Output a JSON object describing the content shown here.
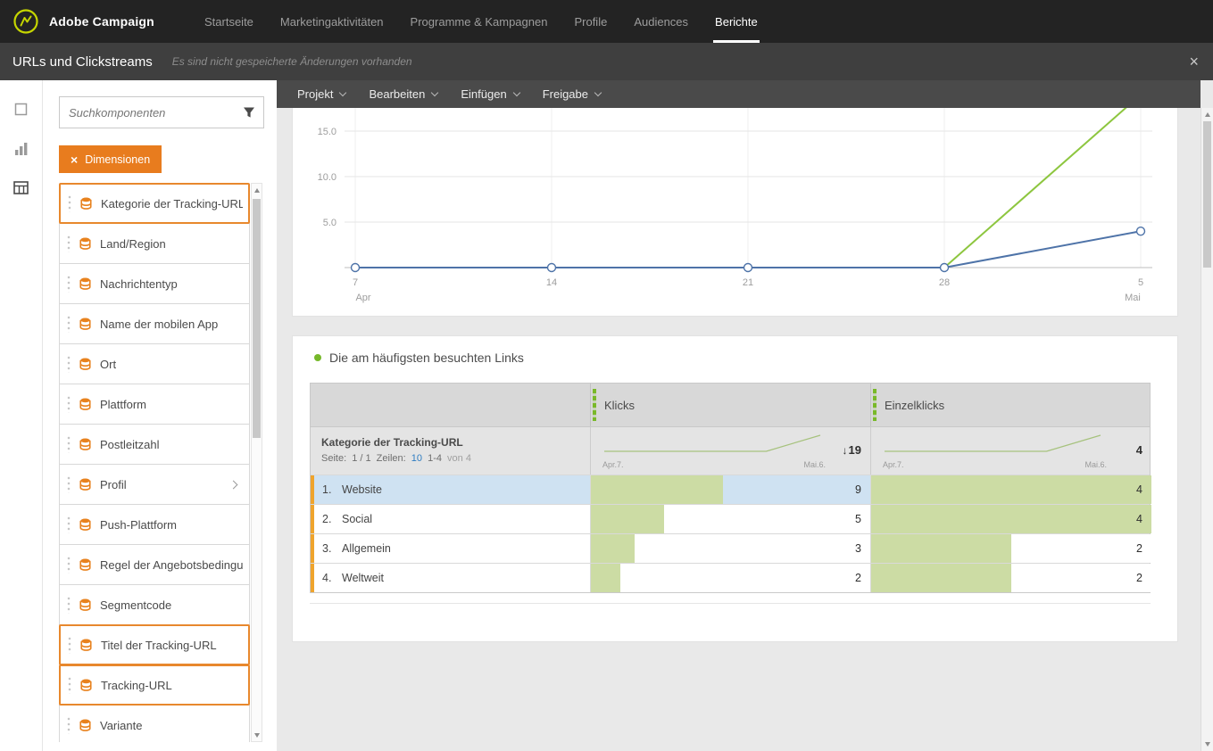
{
  "topnav": {
    "brand": "Adobe Campaign",
    "items": [
      {
        "label": "Startseite",
        "active": false
      },
      {
        "label": "Marketingaktivitäten",
        "active": false
      },
      {
        "label": "Programme & Kampagnen",
        "active": false
      },
      {
        "label": "Profile",
        "active": false
      },
      {
        "label": "Audiences",
        "active": false
      },
      {
        "label": "Berichte",
        "active": true
      }
    ]
  },
  "subheader": {
    "title": "URLs und Clickstreams",
    "status": "Es sind nicht gespeicherte Änderungen vorhanden",
    "close_glyph": "×"
  },
  "left_rail": {
    "icons": [
      "component-square-icon",
      "bar-chart-icon",
      "table-grid-icon"
    ]
  },
  "palette": {
    "search_placeholder": "Suchkomponenten",
    "category_button_label": "Dimensionen",
    "category_button_icon": "×",
    "items": [
      {
        "label": "Kategorie der Tracking-URL",
        "highlighted": true
      },
      {
        "label": "Land/Region"
      },
      {
        "label": "Nachrichtentyp"
      },
      {
        "label": "Name der mobilen App"
      },
      {
        "label": "Ort"
      },
      {
        "label": "Plattform"
      },
      {
        "label": "Postleitzahl"
      },
      {
        "label": "Profil",
        "expandable": true
      },
      {
        "label": "Push-Plattform"
      },
      {
        "label": "Regel der Angebotsbedingung"
      },
      {
        "label": "Segmentcode"
      },
      {
        "label": "Titel der Tracking-URL",
        "highlighted": true
      },
      {
        "label": "Tracking-URL",
        "highlighted": true
      },
      {
        "label": "Variante"
      }
    ]
  },
  "menubar": {
    "items": [
      "Projekt",
      "Bearbeiten",
      "Einfügen",
      "Freigabe"
    ]
  },
  "chart_data": {
    "type": "line",
    "title": "",
    "xlabel": "",
    "ylabel": "",
    "x_ticks": [
      {
        "label": "7",
        "sub": "Apr"
      },
      {
        "label": "14",
        "sub": ""
      },
      {
        "label": "21",
        "sub": ""
      },
      {
        "label": "28",
        "sub": ""
      },
      {
        "label": "5",
        "sub": "Mai"
      }
    ],
    "y_ticks": [
      15.0,
      10.0,
      5.0
    ],
    "ylim": [
      0,
      20
    ],
    "grid": true,
    "legend_visible": false,
    "series": [
      {
        "name": "Klicks",
        "color": "#8dc63f",
        "values": [
          null,
          null,
          null,
          0,
          19
        ],
        "markers": false
      },
      {
        "name": "Einzelklicks",
        "color": "#4e73a8",
        "values": [
          0,
          0,
          0,
          0,
          4
        ],
        "markers": true
      }
    ]
  },
  "links_section": {
    "title": "Die am häufigsten besuchten Links",
    "table": {
      "dimension_header": "Kategorie der Tracking-URL",
      "pagination": {
        "seite_label": "Seite:",
        "seite_value": "1 / 1",
        "zeilen_label": "Zeilen:",
        "zeilen_value": "10",
        "range": "1-4",
        "of": "von 4"
      },
      "columns": [
        {
          "label": "Klicks",
          "date_start": "Apr.7.",
          "date_end": "Mai.6.",
          "trend_arrow": "↓",
          "total": "19",
          "max": 19,
          "spark": [
            0,
            0,
            0,
            0,
            19
          ]
        },
        {
          "label": "Einzelklicks",
          "date_start": "Apr.7.",
          "date_end": "Mai.6.",
          "trend_arrow": "",
          "total": "4",
          "max": 4,
          "spark": [
            0,
            0,
            0,
            0,
            4
          ]
        }
      ],
      "rows": [
        {
          "rank": "1.",
          "label": "Website",
          "klicks": 9,
          "einzelklicks": 4,
          "selected": true
        },
        {
          "rank": "2.",
          "label": "Social",
          "klicks": 5,
          "einzelklicks": 4,
          "selected": false
        },
        {
          "rank": "3.",
          "label": "Allgemein",
          "klicks": 3,
          "einzelklicks": 2,
          "selected": false
        },
        {
          "rank": "4.",
          "label": "Weltweit",
          "klicks": 2,
          "einzelklicks": 2,
          "selected": false
        }
      ]
    }
  },
  "colors": {
    "accent_orange": "#e87c1e",
    "highlight_border": "#e8882d",
    "line_green": "#8dc63f",
    "line_blue": "#4e73a8",
    "bar_green": "#ccdca4",
    "selected_row_blue": "#cfe2f2",
    "rank_amber": "#efa42d",
    "header_gray": "#d8d8d8",
    "topnav_bg": "#232323",
    "subheader_bg": "#3f3f3f"
  }
}
